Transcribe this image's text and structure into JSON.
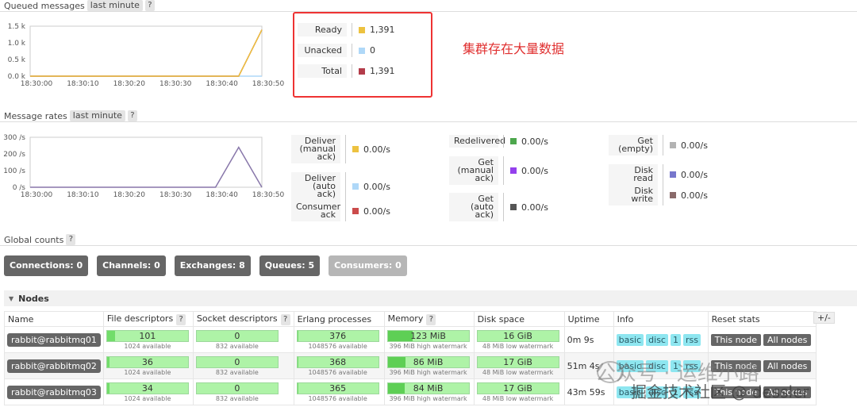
{
  "queued": {
    "title": "Queued messages",
    "range": "last minute",
    "help": "?",
    "chart_data": {
      "type": "line",
      "x": [
        "18:30:00",
        "18:30:10",
        "18:30:20",
        "18:30:30",
        "18:30:40",
        "18:30:50"
      ],
      "ytick_labels": [
        "0.0 k",
        "0.5 k",
        "1.0 k",
        "1.5 k"
      ],
      "ylim": [
        0,
        1500
      ],
      "series": [
        {
          "name": "Ready",
          "color": "#edc240",
          "points": [
            [
              0,
              0
            ],
            [
              45,
              0
            ],
            [
              50,
              1391
            ]
          ]
        },
        {
          "name": "Total",
          "color": "#b33c4a",
          "points": [
            [
              0,
              0
            ],
            [
              45,
              0
            ],
            [
              50,
              1391
            ]
          ]
        },
        {
          "name": "Unacked",
          "color": "#afd8f8",
          "points": [
            [
              0,
              0
            ],
            [
              50,
              0
            ]
          ]
        }
      ]
    },
    "legend": [
      {
        "label": "Ready",
        "value": "1,391",
        "color": "#edc240"
      },
      {
        "label": "Unacked",
        "value": "0",
        "color": "#afd8f8"
      },
      {
        "label": "Total",
        "value": "1,391",
        "color": "#b33c4a"
      }
    ]
  },
  "annotation": "集群存在大量数据",
  "rates": {
    "title": "Message rates",
    "range": "last minute",
    "help": "?",
    "chart_data": {
      "type": "line",
      "x": [
        "18:30:00",
        "18:30:10",
        "18:30:20",
        "18:30:30",
        "18:30:40",
        "18:30:50"
      ],
      "ytick_labels": [
        "0 /s",
        "100 /s",
        "200 /s",
        "300 /s"
      ],
      "ylim": [
        0,
        300
      ],
      "series": [
        {
          "name": "Get (empty)",
          "color": "#8877aa",
          "points": [
            [
              0,
              0
            ],
            [
              40,
              0
            ],
            [
              45,
              240
            ],
            [
              50,
              0
            ]
          ]
        }
      ]
    },
    "columns": [
      [
        {
          "label": "Deliver (manual ack)",
          "value": "0.00/s",
          "color": "#edc240"
        },
        {
          "label": "Deliver (auto ack)",
          "value": "0.00/s",
          "color": "#afd8f8"
        },
        {
          "label": "Consumer ack",
          "value": "0.00/s",
          "color": "#cb4b4b"
        }
      ],
      [
        {
          "label": "Redelivered",
          "value": "0.00/s",
          "color": "#4da74d"
        },
        {
          "label": "Get (manual ack)",
          "value": "0.00/s",
          "color": "#9440ed"
        },
        {
          "label": "Get (auto ack)",
          "value": "0.00/s",
          "color": "#555555"
        }
      ],
      [
        {
          "label": "Get (empty)",
          "value": "0.00/s",
          "color": "#b3b3b3"
        },
        {
          "label": "Disk read",
          "value": "0.00/s",
          "color": "#7777cc"
        },
        {
          "label": "Disk write",
          "value": "0.00/s",
          "color": "#8a6a6a"
        }
      ]
    ]
  },
  "global": {
    "title": "Global counts",
    "help": "?",
    "counts": [
      {
        "label": "Connections:",
        "value": "0"
      },
      {
        "label": "Channels:",
        "value": "0"
      },
      {
        "label": "Exchanges:",
        "value": "8"
      },
      {
        "label": "Queues:",
        "value": "5"
      },
      {
        "label": "Consumers:",
        "value": "0"
      }
    ]
  },
  "nodes": {
    "title": "Nodes",
    "plus_minus": "+/-",
    "headers": [
      "Name",
      "File descriptors",
      "Socket descriptors",
      "Erlang processes",
      "Memory",
      "Disk space",
      "Uptime",
      "Info",
      "Reset stats"
    ],
    "help": "?",
    "rows": [
      {
        "name": "rabbit@rabbitmq01",
        "fd": "101",
        "fd_sub": "1024 available",
        "fd_frac": 0.1,
        "sd": "0",
        "sd_sub": "832 available",
        "sd_frac": 0,
        "ep": "376",
        "ep_sub": "1048576 available",
        "ep_frac": 0.003,
        "mem": "123 MiB",
        "mem_sub": "396 MiB high watermark",
        "mem_frac": 0.31,
        "disk": "16 GiB",
        "disk_sub": "48 MiB low watermark",
        "disk_frac": 0.0,
        "uptime": "0m 9s",
        "info": [
          "basic",
          "disc",
          "1",
          "rss"
        ],
        "reset": [
          "This node",
          "All nodes"
        ]
      },
      {
        "name": "rabbit@rabbitmq02",
        "fd": "36",
        "fd_sub": "1024 available",
        "fd_frac": 0.035,
        "sd": "0",
        "sd_sub": "832 available",
        "sd_frac": 0,
        "ep": "368",
        "ep_sub": "1048576 available",
        "ep_frac": 0.003,
        "mem": "86 MiB",
        "mem_sub": "396 MiB high watermark",
        "mem_frac": 0.22,
        "disk": "17 GiB",
        "disk_sub": "48 MiB low watermark",
        "disk_frac": 0.0,
        "uptime": "51m 4s",
        "info": [
          "basic",
          "disc",
          "1",
          "rss"
        ],
        "reset": [
          "This node",
          "All nodes"
        ]
      },
      {
        "name": "rabbit@rabbitmq03",
        "fd": "34",
        "fd_sub": "1024 available",
        "fd_frac": 0.033,
        "sd": "0",
        "sd_sub": "832 available",
        "sd_frac": 0,
        "ep": "365",
        "ep_sub": "1048576 available",
        "ep_frac": 0.003,
        "mem": "84 MiB",
        "mem_sub": "396 MiB high watermark",
        "mem_frac": 0.21,
        "disk": "17 GiB",
        "disk_sub": "48 MiB low watermark",
        "disk_frac": 0.0,
        "uptime": "43m 59s",
        "info": [
          "basic",
          "disc",
          "1",
          "rss"
        ],
        "reset": [
          "This node",
          "All nodes"
        ]
      }
    ]
  },
  "watermark": {
    "line1": "公众号 · 运维小路",
    "line2": "掘金技术社区 @ dessler"
  }
}
